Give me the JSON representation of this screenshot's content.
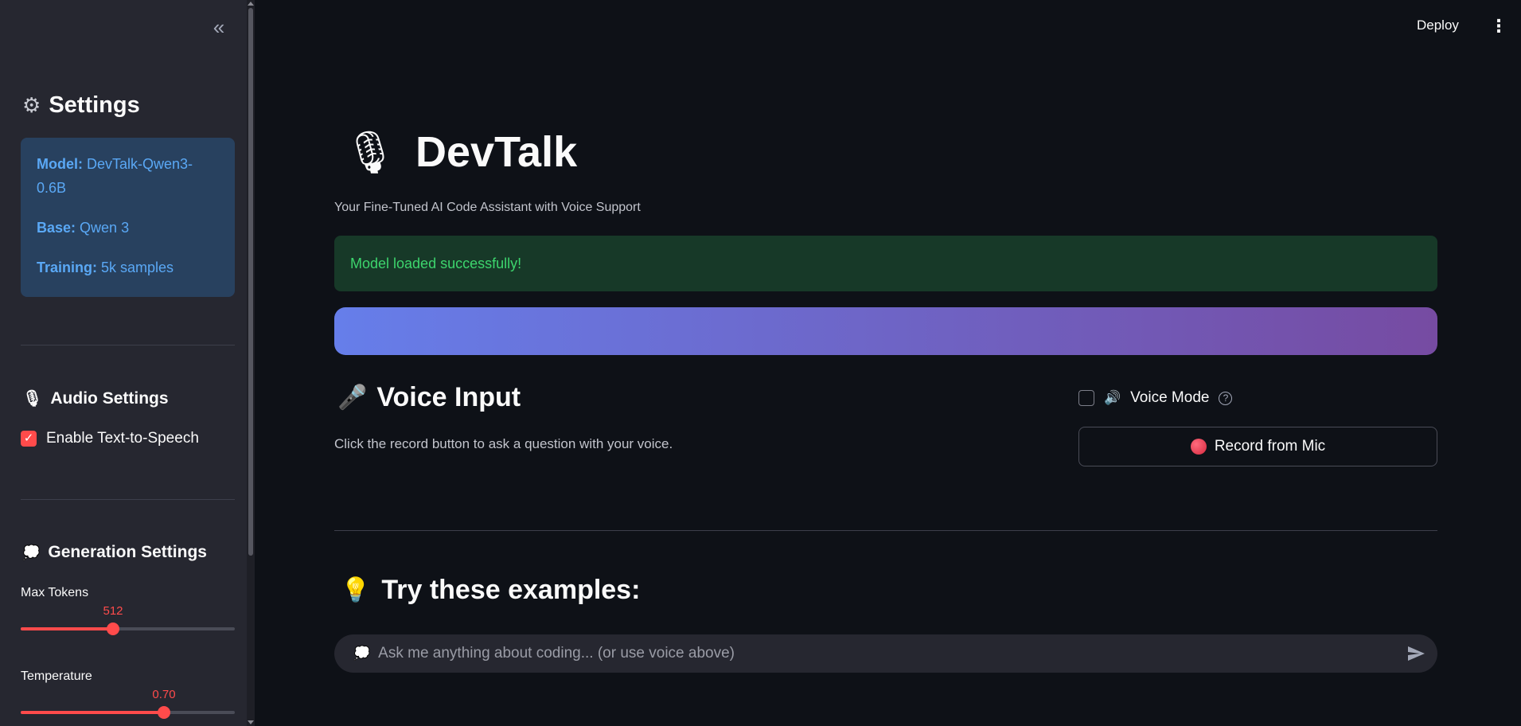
{
  "sidebar": {
    "heading": "Settings",
    "info": {
      "model_label": "Model:",
      "model_value": "DevTalk-Qwen3-0.6B",
      "base_label": "Base:",
      "base_value": "Qwen 3",
      "training_label": "Training:",
      "training_value": "5k samples"
    },
    "audio_heading": "Audio Settings",
    "tts_label": "Enable Text-to-Speech",
    "tts_checked": true,
    "generation_heading": "Generation Settings",
    "max_tokens": {
      "label": "Max Tokens",
      "value": "512",
      "fraction": 0.43
    },
    "temperature": {
      "label": "Temperature",
      "value": "0.70",
      "fraction": 0.67
    }
  },
  "header": {
    "deploy_label": "Deploy"
  },
  "main": {
    "title": "DevTalk",
    "subtitle": "Your Fine-Tuned AI Code Assistant with Voice Support",
    "success_message": "Model loaded successfully!",
    "voice_heading": "Voice Input",
    "voice_desc": "Click the record button to ask a question with your voice.",
    "voice_mode_label": "Voice Mode",
    "record_label": "Record from Mic",
    "examples_heading": "Try these examples:",
    "chat_placeholder": "Ask me anything about coding... (or use voice above)"
  },
  "colors": {
    "accent": "#ff4b4b",
    "success_bg": "#173928",
    "success_text": "#3dd56d",
    "info_bg": "#28415f",
    "info_text": "#5aa8f5",
    "gradient_start": "#667eea",
    "gradient_end": "#764ba2"
  }
}
